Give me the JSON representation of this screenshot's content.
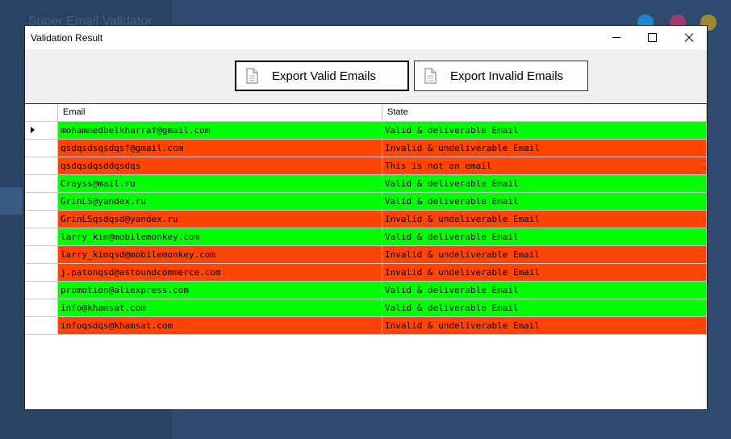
{
  "background": {
    "app_title": "Super Email Validator"
  },
  "window": {
    "title": "Validation Result"
  },
  "toolbar": {
    "export_valid_label": "Export Valid Emails",
    "export_invalid_label": "Export Invalid Emails"
  },
  "grid": {
    "columns": [
      "Email",
      "State"
    ],
    "selected_row": 0,
    "rows": [
      {
        "email": "mohammedbelkharraf@gmail.com",
        "state": "Valid & deliverable Email",
        "status": "valid"
      },
      {
        "email": "qsdqsdsqsdqsf@gmail.com",
        "state": "Invalid & undeliverable Email",
        "status": "invalid"
      },
      {
        "email": "qsdqsdqsddqsdqs",
        "state": "This is not an email",
        "status": "invalid"
      },
      {
        "email": "Crayss@mail.ru",
        "state": "Valid & deliverable Email",
        "status": "valid"
      },
      {
        "email": "GrinLS@yandex.ru",
        "state": "Valid & deliverable Email",
        "status": "valid"
      },
      {
        "email": "GrinLSqsdqsd@yandex.ru",
        "state": "Invalid & undeliverable Email",
        "status": "invalid"
      },
      {
        "email": "larry_kim@mobilemonkey.com",
        "state": "Valid & deliverable Email",
        "status": "valid"
      },
      {
        "email": "larry_kimqsd@mobilemonkey.com",
        "state": "Invalid & undeliverable Email",
        "status": "invalid"
      },
      {
        "email": "j.patonqsd@astoundcommerce.com",
        "state": "Invalid & undeliverable Email",
        "status": "invalid"
      },
      {
        "email": "promotion@aliexpress.com",
        "state": "Valid & deliverable Email",
        "status": "valid"
      },
      {
        "email": "info@khamsat.com",
        "state": "Valid & deliverable Email",
        "status": "valid"
      },
      {
        "email": "infoqsdqs@khamsat.com",
        "state": "Invalid & undeliverable Email",
        "status": "invalid"
      }
    ]
  },
  "colors": {
    "valid": "#00ff00",
    "invalid": "#ff4500"
  },
  "icons": {
    "export_valid": "document-icon",
    "export_invalid": "document-icon"
  }
}
